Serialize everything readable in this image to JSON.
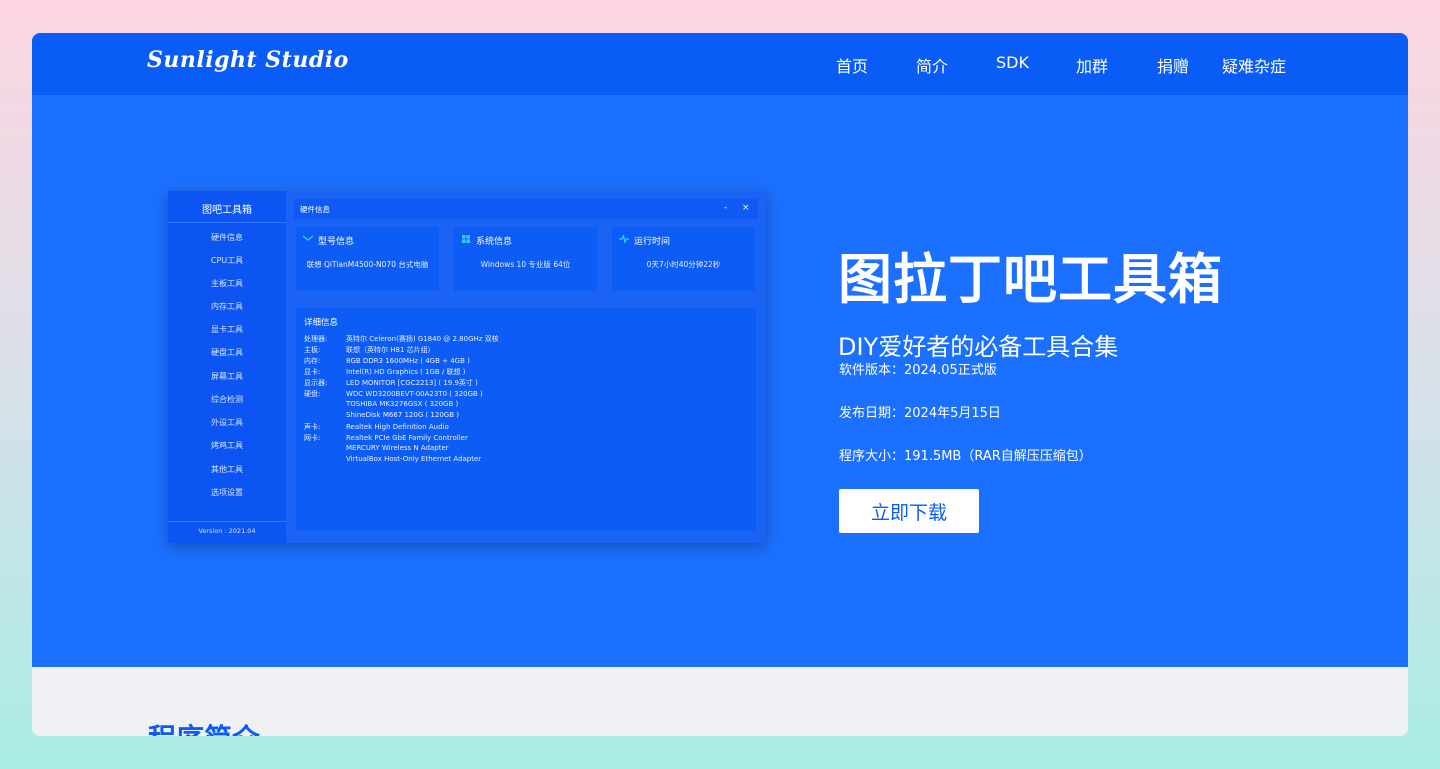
{
  "nav": {
    "logo": "Sunlight Studio",
    "items": [
      "首页",
      "简介",
      "SDK",
      "加群",
      "捐赠",
      "疑难杂症"
    ]
  },
  "hero": {
    "title": "图拉丁吧工具箱",
    "subtitle": "DIY爱好者的必备工具合集",
    "version": "软件版本：2024.05正式版",
    "date": "发布日期：2024年5月15日",
    "size": "程序大小：191.5MB（RAR自解压压缩包）",
    "download_label": "立即下载"
  },
  "screenshot": {
    "sidebar_title": "图吧工具箱",
    "sidebar_items": [
      "硬件信息",
      "CPU工具",
      "主板工具",
      "内存工具",
      "显卡工具",
      "硬盘工具",
      "屏幕工具",
      "综合检测",
      "外设工具",
      "烤鸡工具",
      "其他工具",
      "选项设置"
    ],
    "version": "Version : 2021.04",
    "window_title": "硬件信息",
    "window_min": "-",
    "window_close": "×",
    "cards": [
      {
        "title": "型号信息",
        "value": "联想 QiTianM4500-N070 台式电脑",
        "icon": "monitor-icon"
      },
      {
        "title": "系统信息",
        "value": "Windows 10 专业版 64位",
        "icon": "windows-icon"
      },
      {
        "title": "运行时间",
        "value": "0天7小时40分钟22秒",
        "icon": "pulse-icon"
      }
    ],
    "detail_title": "详细信息",
    "details": [
      {
        "k": "处理器:",
        "v": "英特尔 Celeron(赛扬) G1840 @ 2.80GHz 双核"
      },
      {
        "k": "主板:",
        "v": "联想（英特尔 H81 芯片组）"
      },
      {
        "k": "内存:",
        "v": "8GB DDR3 1600MHz ( 4GB + 4GB )"
      },
      {
        "k": "显卡:",
        "v": "Intel(R) HD Graphics ( 1GB / 联想 )"
      },
      {
        "k": "显示器:",
        "v": "LED MONITOR [CGC2213] ( 19.9英寸 )"
      },
      {
        "k": "硬盘:",
        "v": "WDC WD3200BEVT-00A23T0 ( 320GB )"
      },
      {
        "k": "",
        "v": "TOSHIBA MK3276GSX ( 320GB )"
      },
      {
        "k": "",
        "v": "ShineDisk M667 120G ( 120GB )"
      },
      {
        "k": "声卡:",
        "v": "Realtek High Definition Audio"
      },
      {
        "k": "网卡:",
        "v": "Realtek PCIe GbE Family Controller"
      },
      {
        "k": "",
        "v": "MERCURY Wireless N Adapter"
      },
      {
        "k": "",
        "v": "VirtualBox Host-Only Ethernet Adapter"
      }
    ]
  },
  "section": {
    "title": "程序简介"
  },
  "colors": {
    "nav": "#0a5cf7",
    "hero": "#1c70ff",
    "accent": "#0a5cf7"
  }
}
